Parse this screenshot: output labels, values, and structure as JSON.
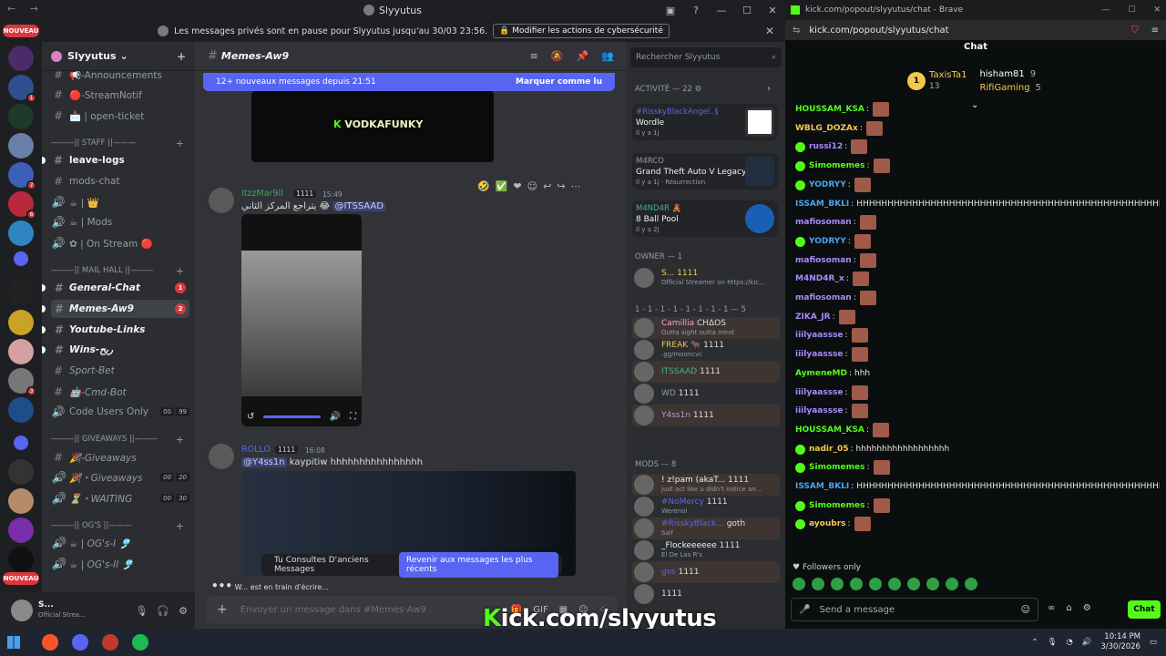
{
  "discord": {
    "window_title": "Slyyutus",
    "nav_arrows": "← →",
    "window_controls": [
      "—",
      "☐",
      "✕"
    ],
    "notice": {
      "text": "Les messages privés sont en pause pour Slyyutus jusqu'au 30/03 23:56.",
      "button": "Modifier les actions de cybersécurité",
      "close": "✕"
    },
    "server_list": {
      "new_badge": "NOUVEAU",
      "new_badge_bottom": "NOUVEAU",
      "badges": [
        "1",
        "7",
        "6",
        "3"
      ]
    },
    "guild": {
      "name": "Slyyutus",
      "chevron": "⌄",
      "add": "+"
    },
    "channels": [
      {
        "name": "📢-Announcements",
        "hash": "#"
      },
      {
        "name": "🔴-StreamNotif",
        "hash": "#"
      },
      {
        "name": "📩 | open-ticket",
        "hash": "#"
      },
      {
        "cat": "———|| STAFF ||———"
      },
      {
        "name": "leave-logs",
        "hash": "#"
      },
      {
        "name": "mods-chat",
        "hash": "#"
      },
      {
        "name": "☕ | 👑",
        "hash": "🔊"
      },
      {
        "name": "☕ | Mods",
        "hash": "🔊"
      },
      {
        "name": "✿ | On Stream 🔴",
        "hash": "🔊"
      },
      {
        "cat": "———|| MAIL HALL ||———"
      },
      {
        "name": "General-Chat",
        "hash": "#",
        "badge": "1"
      },
      {
        "name": "Memes-Aw9",
        "hash": "#",
        "badge": "2"
      },
      {
        "name": "Youtube-Links",
        "hash": "#"
      },
      {
        "name": "Wins-ربح",
        "hash": "#"
      },
      {
        "name": "Sport-Bet",
        "hash": "#"
      },
      {
        "name": "🤖-Cmd-Bot",
        "hash": "#"
      },
      {
        "name": "Code Users Only",
        "hash": "🔊",
        "counts": [
          "00",
          "99"
        ]
      },
      {
        "cat": "———|| GIVEAWAYS ||———"
      },
      {
        "name": "🎉-Giveaways",
        "hash": "#"
      },
      {
        "name": "🎉・Giveaways",
        "hash": "🔊",
        "counts": [
          "00",
          "20"
        ]
      },
      {
        "name": "⏳・WAITING",
        "hash": "🔊",
        "counts": [
          "00",
          "30"
        ]
      },
      {
        "cat": "———|| OG's ||———"
      },
      {
        "name": "☕ | OG's-I 🎐",
        "hash": "🔊"
      },
      {
        "name": "☕ | OG's-II 🎐",
        "hash": "🔊"
      }
    ],
    "user_panel": {
      "name": "S...",
      "status": "Official Strea...",
      "mic": "🎙",
      "headphones": "🎧",
      "settings": "⚙"
    },
    "chat": {
      "channel": "Memes-Aw9",
      "new_messages": "12+ nouveaux messages depuis 21:51",
      "mark_read": "Marquer comme lu",
      "image1_caption": "VODKAFUNKY",
      "msg1": {
        "author": "ItzzMar9ll",
        "tag": "1111",
        "time": "15:49",
        "mention": "@ITSSAAD",
        "text": "يتراجع المركز الثاني 😂"
      },
      "msg2": {
        "author": "ROLLO",
        "tag": "1111",
        "time": "16:08",
        "mention": "@Y4ss1n",
        "text": "kaypitiw hhhhhhhhhhhhhhhh"
      },
      "old_messages": "Tu Consultes D'anciens Messages",
      "jump_recent": "Revenir aux messages les plus récents",
      "typing": "W... est en train d'écrire...",
      "composer_placeholder": "Envoyer un message dans #Memes-Aw9"
    },
    "members": {
      "search_placeholder": "Rechercher Slyyutus",
      "activity_header": "Activité — 22",
      "activities": [
        {
          "name": "#RisskyBlackAngel..§",
          "title": "Wordle",
          "sub": "Il y a 1j"
        },
        {
          "name": "M4RCO",
          "title": "Grand Theft Auto V Legacy",
          "sub": "Il y a 1j · Résurrection"
        },
        {
          "name": "M4ND4R 🧸",
          "title": "8 Ball Pool",
          "sub": "Il y a 2j"
        }
      ],
      "owner_header": "OWNER — 1",
      "owner": {
        "name": "S...",
        "tag": "1111",
        "sub": "Official Streamer on https://kic..."
      },
      "group_header": "1 - 1 - 1 - 1 - 1 - 1 - 1 - 1 — 5",
      "group": [
        {
          "name": "Camillia",
          "tag": "CHΔOS",
          "sub": "Outta sight outta mind",
          "color": "#e9a3d6"
        },
        {
          "name": "FREAK 🐂",
          "tag": "1111",
          "sub": ".gg/mooncvc",
          "color": "#f2c94c"
        },
        {
          "name": "ITSSAAD",
          "tag": "1111",
          "sub": "",
          "color": "#43b581"
        },
        {
          "name": "WD",
          "tag": "1111",
          "sub": "",
          "color": "#949ba4"
        },
        {
          "name": "Y4ss1n",
          "tag": "1111",
          "sub": "",
          "color": "#b39ddb"
        }
      ],
      "mods_header": "MODS — 8",
      "mods": [
        {
          "name": "! z!pam (akaT...",
          "tag": "1111",
          "sub": "just act like u didn't notice an...",
          "color": "#f2f3f5"
        },
        {
          "name": "#NoMercy",
          "tag": "1111",
          "sub": "Werenoi",
          "color": "#5865f2"
        },
        {
          "name": "#RisskyBlack...",
          "tag": "goth",
          "sub": "Saif",
          "color": "#5865f2"
        },
        {
          "name": "_Flockeeeeee",
          "tag": "1111",
          "sub": "El De Las R's",
          "color": "#f2f3f5"
        },
        {
          "name": "gvs",
          "tag": "1111",
          "sub": "",
          "color": "#5865f2"
        },
        {
          "name": "",
          "tag": "1111",
          "sub": "",
          "color": "#f2f3f5"
        }
      ]
    }
  },
  "brave": {
    "tab_title": "kick.com/popout/slyyutus/chat - Brave",
    "window_controls": [
      "—",
      "☐",
      "✕"
    ],
    "url": "kick.com/popout/slyyutus/chat",
    "kick": {
      "title": "Chat",
      "leaderboard": [
        {
          "rank": "1",
          "name": "TaxisTa1",
          "count": "13"
        },
        {
          "name": "hisham81",
          "count": "9"
        },
        {
          "name": "RifiGaming",
          "count": "5"
        }
      ],
      "messages": [
        {
          "user": "HOUSSAM_KSA",
          "color": "#53fc18",
          "text": "",
          "emote": true,
          "badge": false
        },
        {
          "user": "WBLG_DOZAx",
          "color": "#f2c94c",
          "text": "",
          "emote": true,
          "badge": false
        },
        {
          "user": "russi12",
          "color": "#a78bfa",
          "text": "",
          "emote": true,
          "badge": true
        },
        {
          "user": "Simomemes",
          "color": "#53fc18",
          "text": "",
          "emote": true,
          "badge": true
        },
        {
          "user": "YODRYY",
          "color": "#4aa3f0",
          "text": "",
          "emote": true,
          "badge": true
        },
        {
          "user": "ISSAM_BKLI",
          "color": "#4aa3f0",
          "text": "HHHHHHHHHHHHHHHHHHHHHHHHHHHHHHHHHHHHHHHHHHHHHHHHHHHHHHHHHHHHHHHHHHHH",
          "emote": false,
          "badge": false
        },
        {
          "user": "mafiosoman",
          "color": "#a78bfa",
          "text": "",
          "emote": true,
          "badge": false
        },
        {
          "user": "YODRYY",
          "color": "#4aa3f0",
          "text": "",
          "emote": true,
          "badge": true
        },
        {
          "user": "mafiosoman",
          "color": "#a78bfa",
          "text": "",
          "emote": true,
          "badge": false
        },
        {
          "user": "M4ND4R_x",
          "color": "#a78bfa",
          "text": "",
          "emote": true,
          "badge": false
        },
        {
          "user": "mafiosoman",
          "color": "#a78bfa",
          "text": "",
          "emote": true,
          "badge": false
        },
        {
          "user": "ZIKA_JR",
          "color": "#a78bfa",
          "text": "",
          "emote": true,
          "badge": false
        },
        {
          "user": "iiilyaassse",
          "color": "#a78bfa",
          "text": "",
          "emote": true,
          "badge": false
        },
        {
          "user": "iiilyaassse",
          "color": "#a78bfa",
          "text": "",
          "emote": true,
          "badge": false
        },
        {
          "user": "AymeneMD",
          "color": "#53fc18",
          "text": "hhh",
          "emote": false,
          "badge": false
        },
        {
          "user": "iiilyaassse",
          "color": "#a78bfa",
          "text": "",
          "emote": true,
          "badge": false
        },
        {
          "user": "iiilyaassse",
          "color": "#a78bfa",
          "text": "",
          "emote": true,
          "badge": false
        },
        {
          "user": "HOUSSAM_KSA",
          "color": "#53fc18",
          "text": "",
          "emote": true,
          "badge": false
        },
        {
          "user": "nadir_05",
          "color": "#f2c94c",
          "text": "hhhhhhhhhhhhhhhhhh",
          "emote": false,
          "badge": true
        },
        {
          "user": "Simomemes",
          "color": "#53fc18",
          "text": "",
          "emote": true,
          "badge": true
        },
        {
          "user": "ISSAM_BKLI",
          "color": "#4aa3f0",
          "text": "HHHHHHHHHHHHHHHHHHHHHHHHHHHHHHHHHHHHHHHHHHHHHHHHHHHHHHHHHHHHHHHHHHHH",
          "emote": false,
          "badge": false
        },
        {
          "user": "Simomemes",
          "color": "#53fc18",
          "text": "",
          "emote": true,
          "badge": true
        },
        {
          "user": "ayoubrs",
          "color": "#f2c94c",
          "text": "",
          "emote": true,
          "badge": true
        }
      ],
      "followers_only": "Followers only",
      "input_placeholder": "Send a message",
      "chat_button": "Chat"
    }
  },
  "watermark": {
    "k": "K",
    "rest": "ick.com/slyyutus"
  },
  "taskbar": {
    "time": "10:14 PM",
    "date": "3/30/2026"
  }
}
